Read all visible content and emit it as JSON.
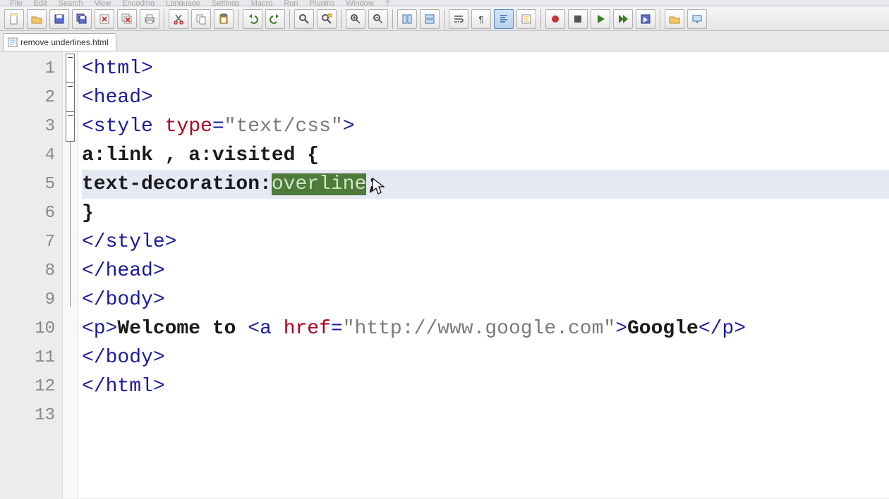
{
  "menu": [
    "File",
    "Edit",
    "Search",
    "View",
    "Encoding",
    "Language",
    "Settings",
    "Macro",
    "Run",
    "Plugins",
    "Window",
    "?"
  ],
  "tab": {
    "label": "remove underlines.html"
  },
  "gutter": [
    "1",
    "2",
    "3",
    "4",
    "5",
    "6",
    "7",
    "8",
    "9",
    "10",
    "11",
    "12",
    "13"
  ],
  "code": {
    "l1": {
      "t1": "<html>"
    },
    "l2": {
      "t1": "<head>"
    },
    "l3": {
      "t1": "<style ",
      "a1": "type",
      "eq": "=",
      "s1": "\"text/css\"",
      "t2": ">"
    },
    "l4": {
      "x1": "a:link , a:visited {"
    },
    "l5": {
      "x1": "text-decoration:",
      "hl": "overline",
      "x2": ";"
    },
    "l6": {
      "x1": "}"
    },
    "l7": {
      "t1": "</style>"
    },
    "l8": {
      "t1": "</head>"
    },
    "l9": {
      "t1": "</body>"
    },
    "l10": {
      "t1": "<p>",
      "x1": "Welcome to ",
      "t2": "<a ",
      "a1": "href",
      "eq": "=",
      "s1": "\"http://www.google.com\"",
      "t3": ">",
      "x2": "Google",
      "t4": "</p>"
    },
    "l11": {
      "t1": "</body>"
    },
    "l12": {
      "t1": "</html>"
    }
  },
  "toolbar_icons": [
    "new-file",
    "open-file",
    "save",
    "save-all",
    "close",
    "close-all",
    "print",
    "cut",
    "copy",
    "paste",
    "undo",
    "redo",
    "find",
    "replace",
    "zoom-in",
    "zoom-out",
    "sync-v",
    "sync-h",
    "word-wrap",
    "show-all",
    "indent-guide",
    "folder",
    "macro-record",
    "macro-stop",
    "macro-play",
    "macro-play-multi",
    "macro-save",
    "open-folder",
    "monitor"
  ]
}
